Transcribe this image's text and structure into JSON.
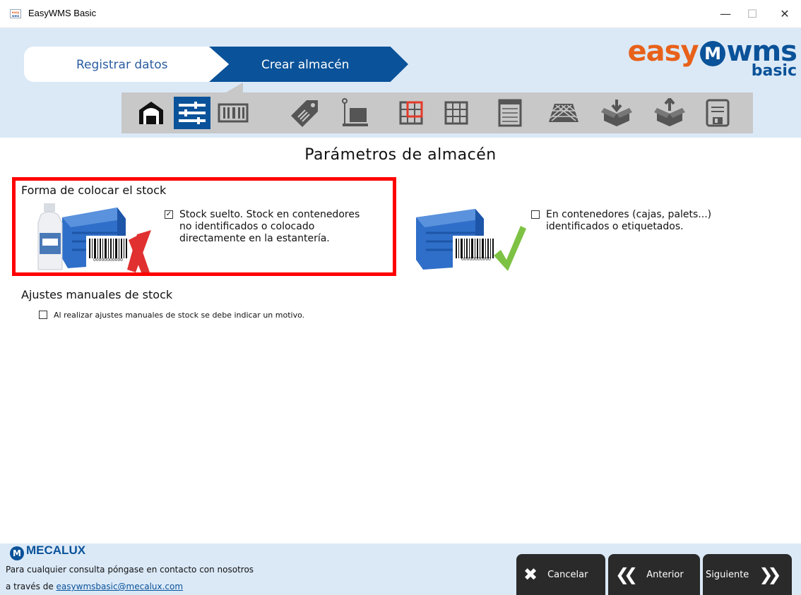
{
  "window": {
    "icon_text_top": "easy",
    "icon_text_bottom": "wms",
    "title": "EasyWMS Basic",
    "minimize": "—",
    "maximize": "☐",
    "close": "✕"
  },
  "wizard": {
    "steps": [
      {
        "label": "Registrar datos",
        "state": "done"
      },
      {
        "label": "Crear almacén",
        "state": "current"
      }
    ]
  },
  "logo": {
    "easy": "easy",
    "wms": "wms",
    "basic": "basic"
  },
  "toolbar": {
    "icons": [
      "warehouse-icon",
      "sliders-icon",
      "barcode-icon",
      "tag-icon",
      "pallet-icon",
      "grid-red-icon",
      "grid-icon",
      "rack-icon",
      "net-icon",
      "box-in-icon",
      "box-out-icon",
      "save-icon"
    ],
    "active_index": 1
  },
  "main": {
    "title": "Parámetros de almacén",
    "stock_section": {
      "heading": "Forma de colocar el stock",
      "options": [
        {
          "checked": true,
          "label": "Stock suelto. Stock en contenedores no identificados o colocado directamente en la estantería.",
          "lines": [
            "Stock suelto. Stock en contenedores",
            "no identificados o colocado",
            "directamente en la estantería."
          ],
          "barcode_number": "00000000000"
        },
        {
          "checked": false,
          "label": "En contenedores (cajas, palets...) identificados o etiquetados.",
          "lines": [
            "En contenedores (cajas, palets...)",
            "identificados o etiquetados."
          ],
          "barcode_number": "00000000000"
        }
      ]
    },
    "adjust_section": {
      "heading": "Ajustes manuales de stock",
      "checkbox": {
        "checked": false,
        "label": "Al realizar ajustes manuales de stock se debe indicar un motivo."
      }
    }
  },
  "footer": {
    "brand": "MECALUX",
    "contact_line1": "Para cualquier consulta póngase en contacto con nosotros",
    "contact_prefix": "a través de",
    "contact_email": "easywmsbasic@mecalux.com",
    "buttons": {
      "cancel": "Cancelar",
      "prev": "Anterior",
      "next": "Siguiente"
    }
  },
  "colors": {
    "brand_blue": "#0a5299",
    "brand_orange": "#e8611a",
    "header_bg": "#dbe9f7",
    "highlight": "#ff0000"
  }
}
